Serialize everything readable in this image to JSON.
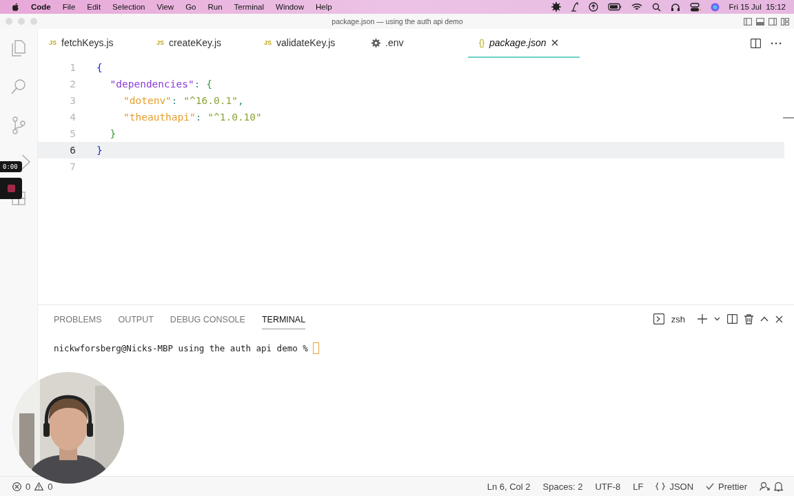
{
  "menu_bar": {
    "app": "Code",
    "items": [
      "File",
      "Edit",
      "Selection",
      "View",
      "Go",
      "Run",
      "Terminal",
      "Window",
      "Help"
    ],
    "clock": "Fri 15 Jul  15:12"
  },
  "window": {
    "title": "package.json — using the auth api demo"
  },
  "tabs": [
    {
      "label": "fetchKeys.js",
      "icon": "JS",
      "kind": "js",
      "selected": false
    },
    {
      "label": "createKey.js",
      "icon": "JS",
      "kind": "js",
      "selected": false
    },
    {
      "label": "validateKey.js",
      "icon": "JS",
      "kind": "js",
      "selected": false
    },
    {
      "label": ".env",
      "kind": "settings",
      "selected": false
    },
    {
      "label": "package.json",
      "icon": "{}",
      "kind": "json",
      "selected": true
    }
  ],
  "editor": {
    "lines": [
      {
        "number": "1",
        "current": false,
        "tokens": [
          {
            "text": "{",
            "kind": "open1"
          }
        ]
      },
      {
        "number": "2",
        "current": false,
        "tokens": [
          {
            "text": "\"dependencies\"",
            "kind": "key1"
          },
          {
            "text": ": ",
            "kind": "punct"
          },
          {
            "text": "{",
            "kind": "open2"
          }
        ]
      },
      {
        "number": "3",
        "current": false,
        "tokens": [
          {
            "text": "\"dotenv\"",
            "kind": "key2"
          },
          {
            "text": ": ",
            "kind": "punct"
          },
          {
            "text": "\"^16.0.1\"",
            "kind": "string"
          },
          {
            "text": ",",
            "kind": "punct"
          }
        ]
      },
      {
        "number": "4",
        "current": false,
        "tokens": [
          {
            "text": "\"theauthapi\"",
            "kind": "key2"
          },
          {
            "text": ": ",
            "kind": "punct"
          },
          {
            "text": "\"^1.0.10\"",
            "kind": "string"
          }
        ]
      },
      {
        "number": "5",
        "current": false,
        "tokens": [
          {
            "text": "}",
            "kind": "close2"
          }
        ]
      },
      {
        "number": "6",
        "current": true,
        "tokens": [
          {
            "text": "}",
            "kind": "close1"
          }
        ]
      },
      {
        "number": "7",
        "current": false
      }
    ]
  },
  "recorder": {
    "time": "0:00"
  },
  "panel": {
    "tabs": [
      {
        "label": "PROBLEMS",
        "selected": false
      },
      {
        "label": "OUTPUT",
        "selected": false
      },
      {
        "label": "DEBUG CONSOLE",
        "selected": false
      },
      {
        "label": "TERMINAL",
        "selected": true
      }
    ],
    "shell": "zsh",
    "prompt": "nickwforsberg@Nicks-MBP using the auth api demo % "
  },
  "status_bar": {
    "errors": "0",
    "warnings": "0",
    "position": "Ln 6, Col 2",
    "spaces": "Spaces: 2",
    "encoding": "UTF-8",
    "eol": "LF",
    "language": "JSON",
    "formatter": "Prettier"
  }
}
